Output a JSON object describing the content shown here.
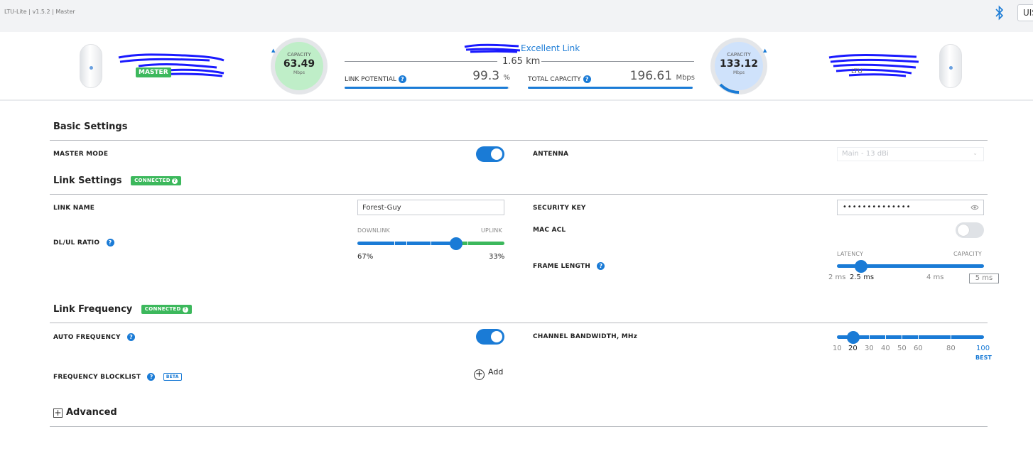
{
  "app": {
    "title": "LTU-Lite | v1.5.2 | Master",
    "user_button": "UIS",
    "bluetooth_icon": "bluetooth-icon"
  },
  "link_header": {
    "local": {
      "role": "MASTER",
      "capacity_label": "CAPACITY",
      "capacity_value": "63.49",
      "capacity_unit": "Mbps"
    },
    "remote": {
      "role": "LTU",
      "capacity_label": "CAPACITY",
      "capacity_value": "133.12",
      "capacity_unit": "Mbps"
    },
    "link_quality": "Excellent Link",
    "distance": "1.65 km",
    "link_potential": {
      "label": "LINK POTENTIAL",
      "value": "99.3",
      "unit": "%",
      "fill": 0.993
    },
    "total_capacity": {
      "label": "TOTAL CAPACITY",
      "value": "196.61",
      "unit": "Mbps",
      "fill": 1.0
    },
    "colors": {
      "accent": "#1a7bd6",
      "good": "#3cb85c"
    }
  },
  "basic_settings": {
    "title": "Basic Settings",
    "master_mode": {
      "label": "MASTER MODE",
      "enabled": true
    },
    "antenna": {
      "label": "ANTENNA",
      "value": "Main - 13 dBi"
    }
  },
  "link_settings": {
    "title": "Link Settings",
    "status": "CONNECTED",
    "link_name": {
      "label": "LINK NAME",
      "value": "Forest-Guy"
    },
    "security_key": {
      "label": "SECURITY KEY",
      "value": "••••••••••••••"
    },
    "dl_ul_ratio": {
      "label": "DL/UL RATIO",
      "downlink_label": "DOWNLINK",
      "uplink_label": "UPLINK",
      "downlink_pct": "67%",
      "uplink_pct": "33%",
      "downlink_fraction": 0.67
    },
    "mac_acl": {
      "label": "MAC ACL",
      "enabled": false
    },
    "frame_length": {
      "label": "FRAME LENGTH",
      "latency_label": "LATENCY",
      "capacity_label": "CAPACITY",
      "marks": [
        "2 ms",
        "2.5 ms",
        "4 ms",
        "5 ms"
      ],
      "selected": "2.5 ms"
    }
  },
  "link_frequency": {
    "title": "Link Frequency",
    "status": "CONNECTED",
    "auto_frequency": {
      "label": "AUTO FREQUENCY",
      "enabled": true
    },
    "channel_bandwidth": {
      "label": "CHANNEL BANDWIDTH, MHz",
      "options": [
        "10",
        "20",
        "30",
        "40",
        "50",
        "60",
        "80",
        "100"
      ],
      "selected": "20",
      "best_label": "BEST"
    },
    "frequency_blocklist": {
      "label": "FREQUENCY BLOCKLIST",
      "badge": "BETA",
      "add_label": "Add"
    }
  },
  "advanced": {
    "title": "Advanced"
  }
}
